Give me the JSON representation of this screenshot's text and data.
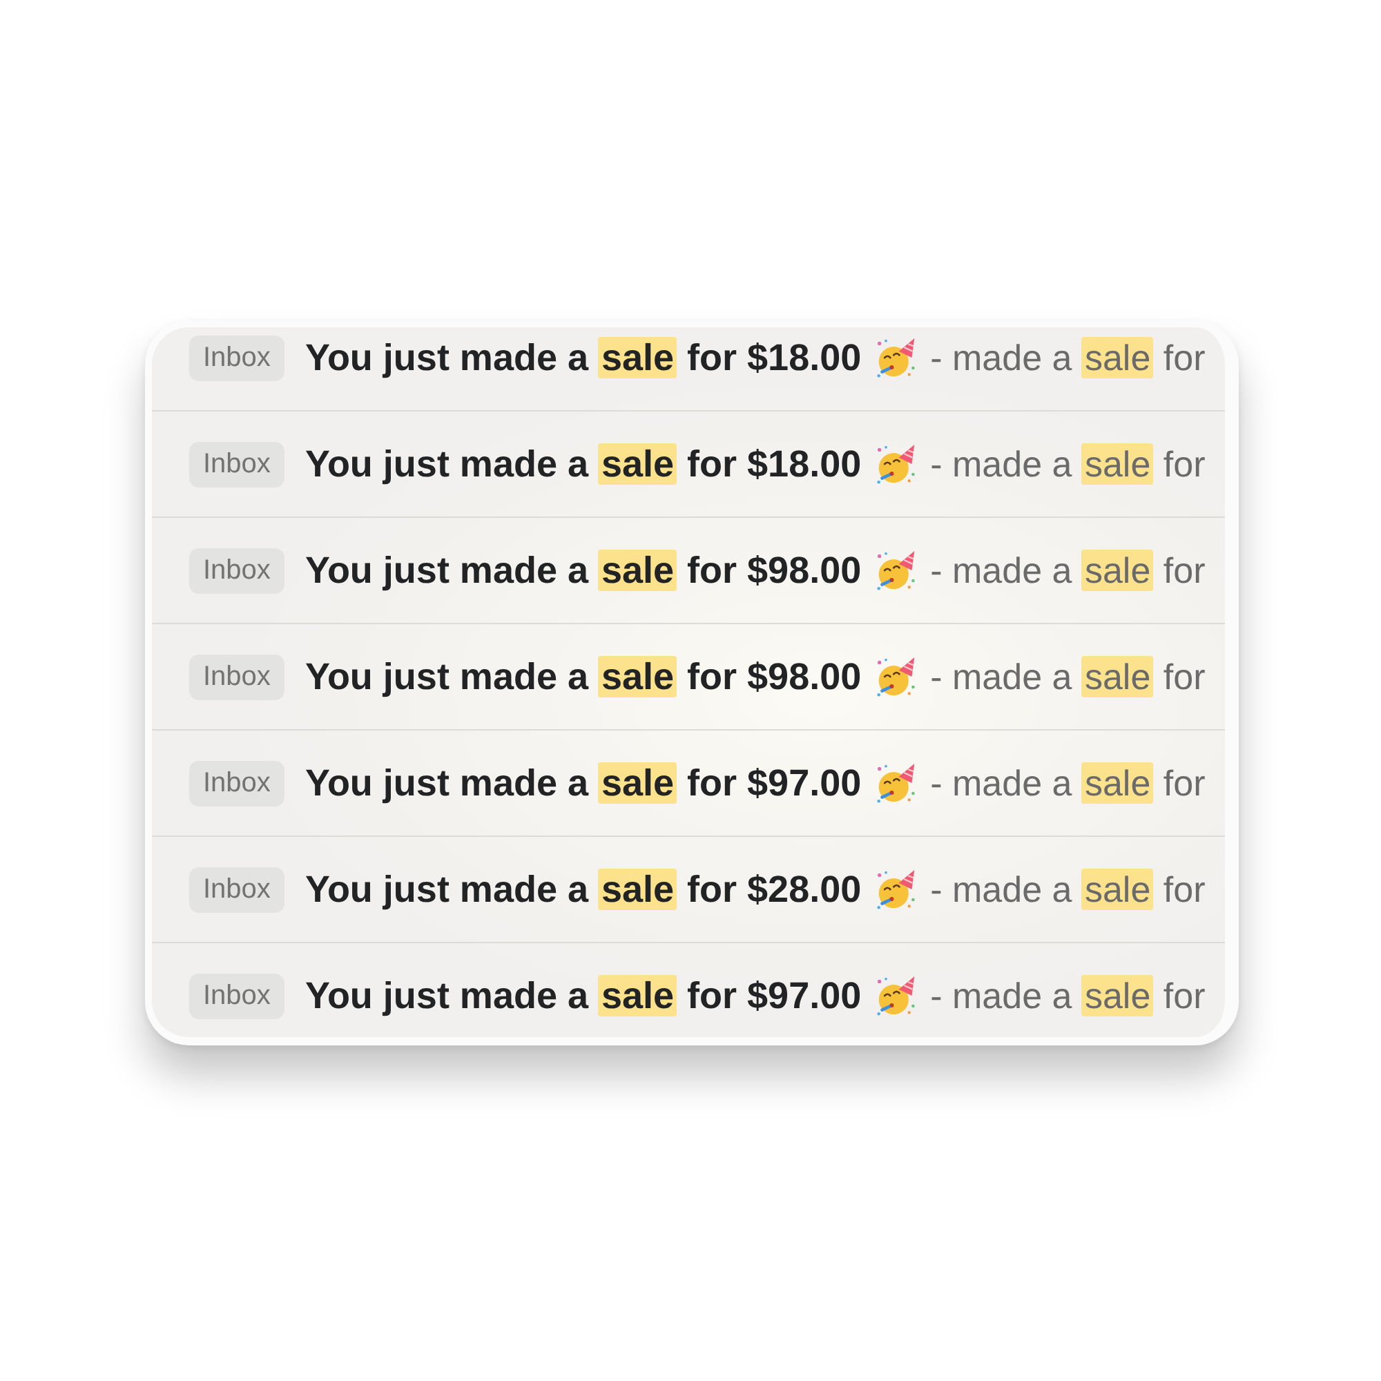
{
  "emails": [
    {
      "label": "Inbox",
      "subject": [
        {
          "text": "You just made a ",
          "highlighted": false
        },
        {
          "text": "sale",
          "highlighted": true
        },
        {
          "text": " for $18.00",
          "highlighted": false
        }
      ],
      "snippet": [
        {
          "text": "- made a ",
          "highlighted": false
        },
        {
          "text": "sale",
          "highlighted": true
        },
        {
          "text": " for",
          "highlighted": false
        }
      ]
    },
    {
      "label": "Inbox",
      "subject": [
        {
          "text": "You just made a ",
          "highlighted": false
        },
        {
          "text": "sale",
          "highlighted": true
        },
        {
          "text": " for $18.00",
          "highlighted": false
        }
      ],
      "snippet": [
        {
          "text": "- made a ",
          "highlighted": false
        },
        {
          "text": "sale",
          "highlighted": true
        },
        {
          "text": " for",
          "highlighted": false
        }
      ]
    },
    {
      "label": "Inbox",
      "subject": [
        {
          "text": "You just made a ",
          "highlighted": false
        },
        {
          "text": "sale",
          "highlighted": true
        },
        {
          "text": " for $98.00",
          "highlighted": false
        }
      ],
      "snippet": [
        {
          "text": "- made a ",
          "highlighted": false
        },
        {
          "text": "sale",
          "highlighted": true
        },
        {
          "text": " for",
          "highlighted": false
        }
      ]
    },
    {
      "label": "Inbox",
      "subject": [
        {
          "text": "You just made a ",
          "highlighted": false
        },
        {
          "text": "sale",
          "highlighted": true
        },
        {
          "text": " for $98.00",
          "highlighted": false
        }
      ],
      "snippet": [
        {
          "text": "- made a ",
          "highlighted": false
        },
        {
          "text": "sale",
          "highlighted": true
        },
        {
          "text": " for",
          "highlighted": false
        }
      ]
    },
    {
      "label": "Inbox",
      "subject": [
        {
          "text": "You just made a ",
          "highlighted": false
        },
        {
          "text": "sale",
          "highlighted": true
        },
        {
          "text": " for $97.00",
          "highlighted": false
        }
      ],
      "snippet": [
        {
          "text": "- made a ",
          "highlighted": false
        },
        {
          "text": "sale",
          "highlighted": true
        },
        {
          "text": " for",
          "highlighted": false
        }
      ]
    },
    {
      "label": "Inbox",
      "subject": [
        {
          "text": "You just made a ",
          "highlighted": false
        },
        {
          "text": "sale",
          "highlighted": true
        },
        {
          "text": " for $28.00",
          "highlighted": false
        }
      ],
      "snippet": [
        {
          "text": "- made a ",
          "highlighted": false
        },
        {
          "text": "sale",
          "highlighted": true
        },
        {
          "text": " for",
          "highlighted": false
        }
      ]
    },
    {
      "label": "Inbox",
      "subject": [
        {
          "text": "You just made a ",
          "highlighted": false
        },
        {
          "text": "sale",
          "highlighted": true
        },
        {
          "text": " for $97.00",
          "highlighted": false
        }
      ],
      "snippet": [
        {
          "text": "- made a ",
          "highlighted": false
        },
        {
          "text": "sale",
          "highlighted": true
        },
        {
          "text": " for",
          "highlighted": false
        }
      ]
    }
  ]
}
